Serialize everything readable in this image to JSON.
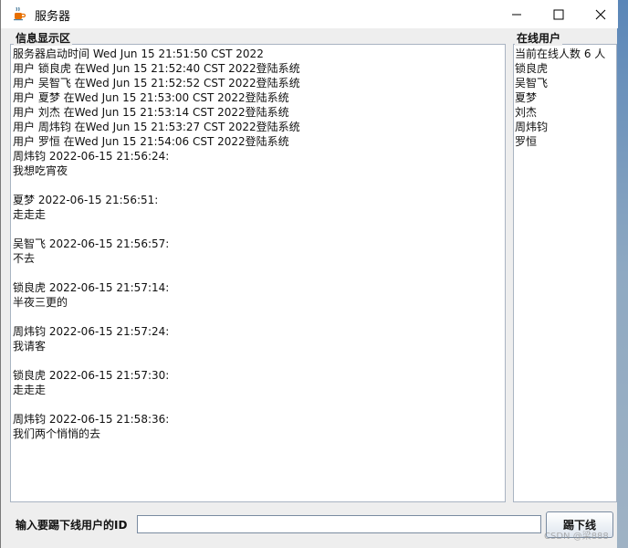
{
  "window": {
    "title": "服务器",
    "icon": "java-coffee-icon"
  },
  "messages_panel": {
    "title": "信息显示区",
    "lines": [
      "服务器启动时间 Wed Jun 15 21:51:50 CST 2022",
      "用户 锁良虎 在Wed Jun 15 21:52:40 CST 2022登陆系统",
      "用户 吴智飞 在Wed Jun 15 21:52:52 CST 2022登陆系统",
      "用户 夏梦 在Wed Jun 15 21:53:00 CST 2022登陆系统",
      "用户 刘杰 在Wed Jun 15 21:53:14 CST 2022登陆系统",
      "用户 周炜钧 在Wed Jun 15 21:53:27 CST 2022登陆系统",
      "用户 罗恒 在Wed Jun 15 21:54:06 CST 2022登陆系统",
      "周炜钧 2022-06-15 21:56:24:",
      "我想吃宵夜",
      "",
      "夏梦 2022-06-15 21:56:51:",
      "走走走",
      "",
      "吴智飞 2022-06-15 21:56:57:",
      "不去",
      "",
      "锁良虎 2022-06-15 21:57:14:",
      "半夜三更的",
      "",
      "周炜钧 2022-06-15 21:57:24:",
      "我请客",
      "",
      "锁良虎 2022-06-15 21:57:30:",
      "走走走",
      "",
      "周炜钧 2022-06-15 21:58:36:",
      "我们两个悄悄的去"
    ]
  },
  "users_panel": {
    "title": "在线用户",
    "count_text": "当前在线人数 6 人",
    "users": [
      "锁良虎",
      "吴智飞",
      "夏梦",
      "刘杰",
      "周炜钧",
      "罗恒"
    ]
  },
  "kick": {
    "label": "输入要踢下线用户的ID",
    "input_value": "",
    "button_label": "踢下线"
  },
  "watermark": "CSDN @梁888",
  "colors": {
    "titlebar_bg": "#ffffff",
    "window_bg": "#eeeeee",
    "field_border": "#a9b4c2"
  }
}
